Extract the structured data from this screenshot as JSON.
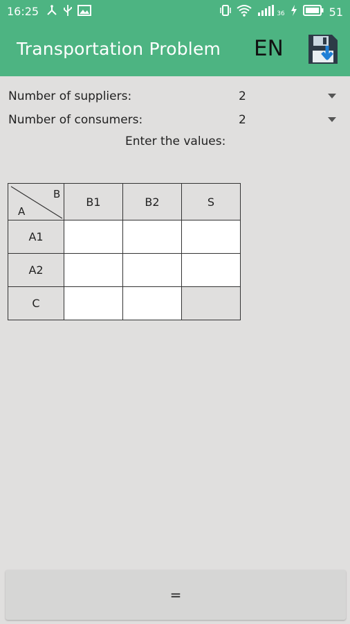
{
  "status_bar": {
    "time": "16:25",
    "network": "36",
    "battery": "51"
  },
  "app_bar": {
    "title": "Transportation Problem",
    "language": "EN"
  },
  "form": {
    "suppliers_label": "Number of suppliers:",
    "suppliers_value": "2",
    "consumers_label": "Number of consumers:",
    "consumers_value": "2",
    "prompt": "Enter the values:"
  },
  "table": {
    "corner_top": "B",
    "corner_bottom": "A",
    "columns": [
      "B1",
      "B2",
      "S"
    ],
    "rows": [
      "A1",
      "A2",
      "C"
    ]
  },
  "actions": {
    "compute_label": "="
  },
  "colors": {
    "accent": "#4db482",
    "background": "#e0dfde"
  }
}
